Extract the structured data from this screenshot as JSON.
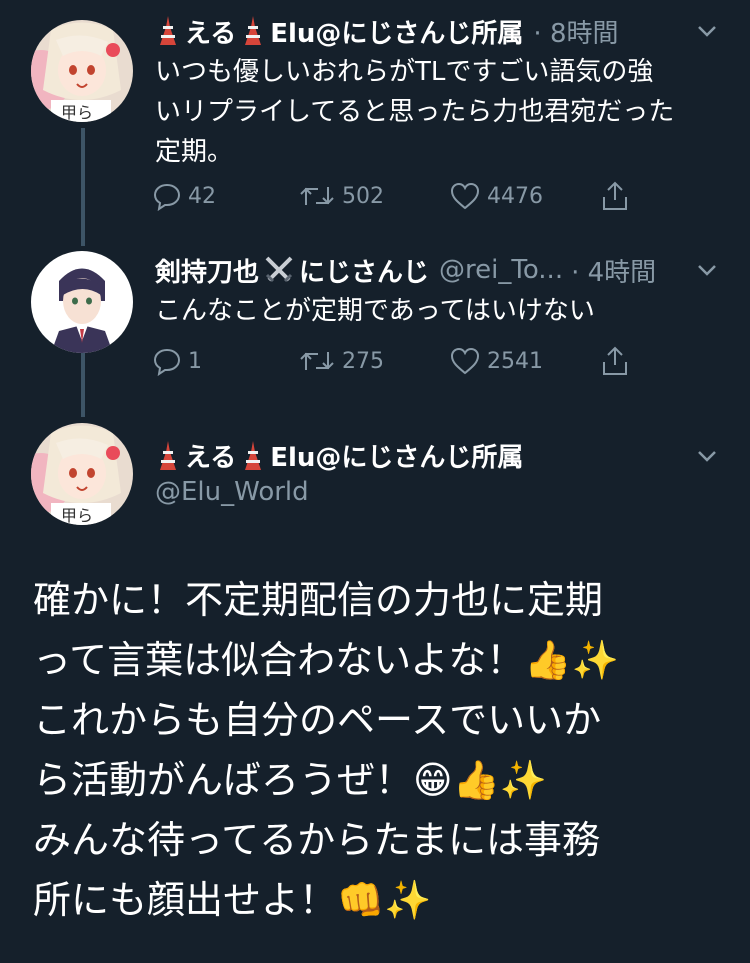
{
  "tweet1": {
    "name": "えるElu@にじさんじ所属",
    "name_part1": "える",
    "name_part2": "Elu@にじさんじ所属",
    "time": "· 8時間",
    "text_lines": [
      "いつも優しいおれらがTLですごい語気の強",
      "いリプライしてると思ったら力也君宛だった",
      "定期。"
    ],
    "replies": "42",
    "retweets": "502",
    "likes": "4476"
  },
  "tweet2": {
    "name_part1": "剣持刀也",
    "name_part2": "にじさんじ",
    "handle": "@rei_To...",
    "time": "· 4時間",
    "text": "こんなことが定期であってはいけない",
    "replies": "1",
    "retweets": "275",
    "likes": "2541"
  },
  "main": {
    "name_part1": "える",
    "name_part2": "Elu@にじさんじ所属",
    "handle": "@Elu_World",
    "lines": [
      "確かに！不定期配信の力也に定期",
      "って言葉は似合わないよな！👍✨",
      "これからも自分のペースでいいか",
      "ら活動がんばろうぜ！😁👍✨",
      "みんな待ってるからたまには事務",
      "所にも顔出せよ！👊✨"
    ]
  },
  "icons": [
    "tower-emoji-icon",
    "swords-emoji-icon",
    "chevron-down-icon",
    "reply-icon",
    "retweet-icon",
    "like-icon",
    "share-icon"
  ],
  "colors": {
    "background": "#15202b",
    "secondary_text": "#8899a6",
    "thread_line": "#3d5466"
  }
}
